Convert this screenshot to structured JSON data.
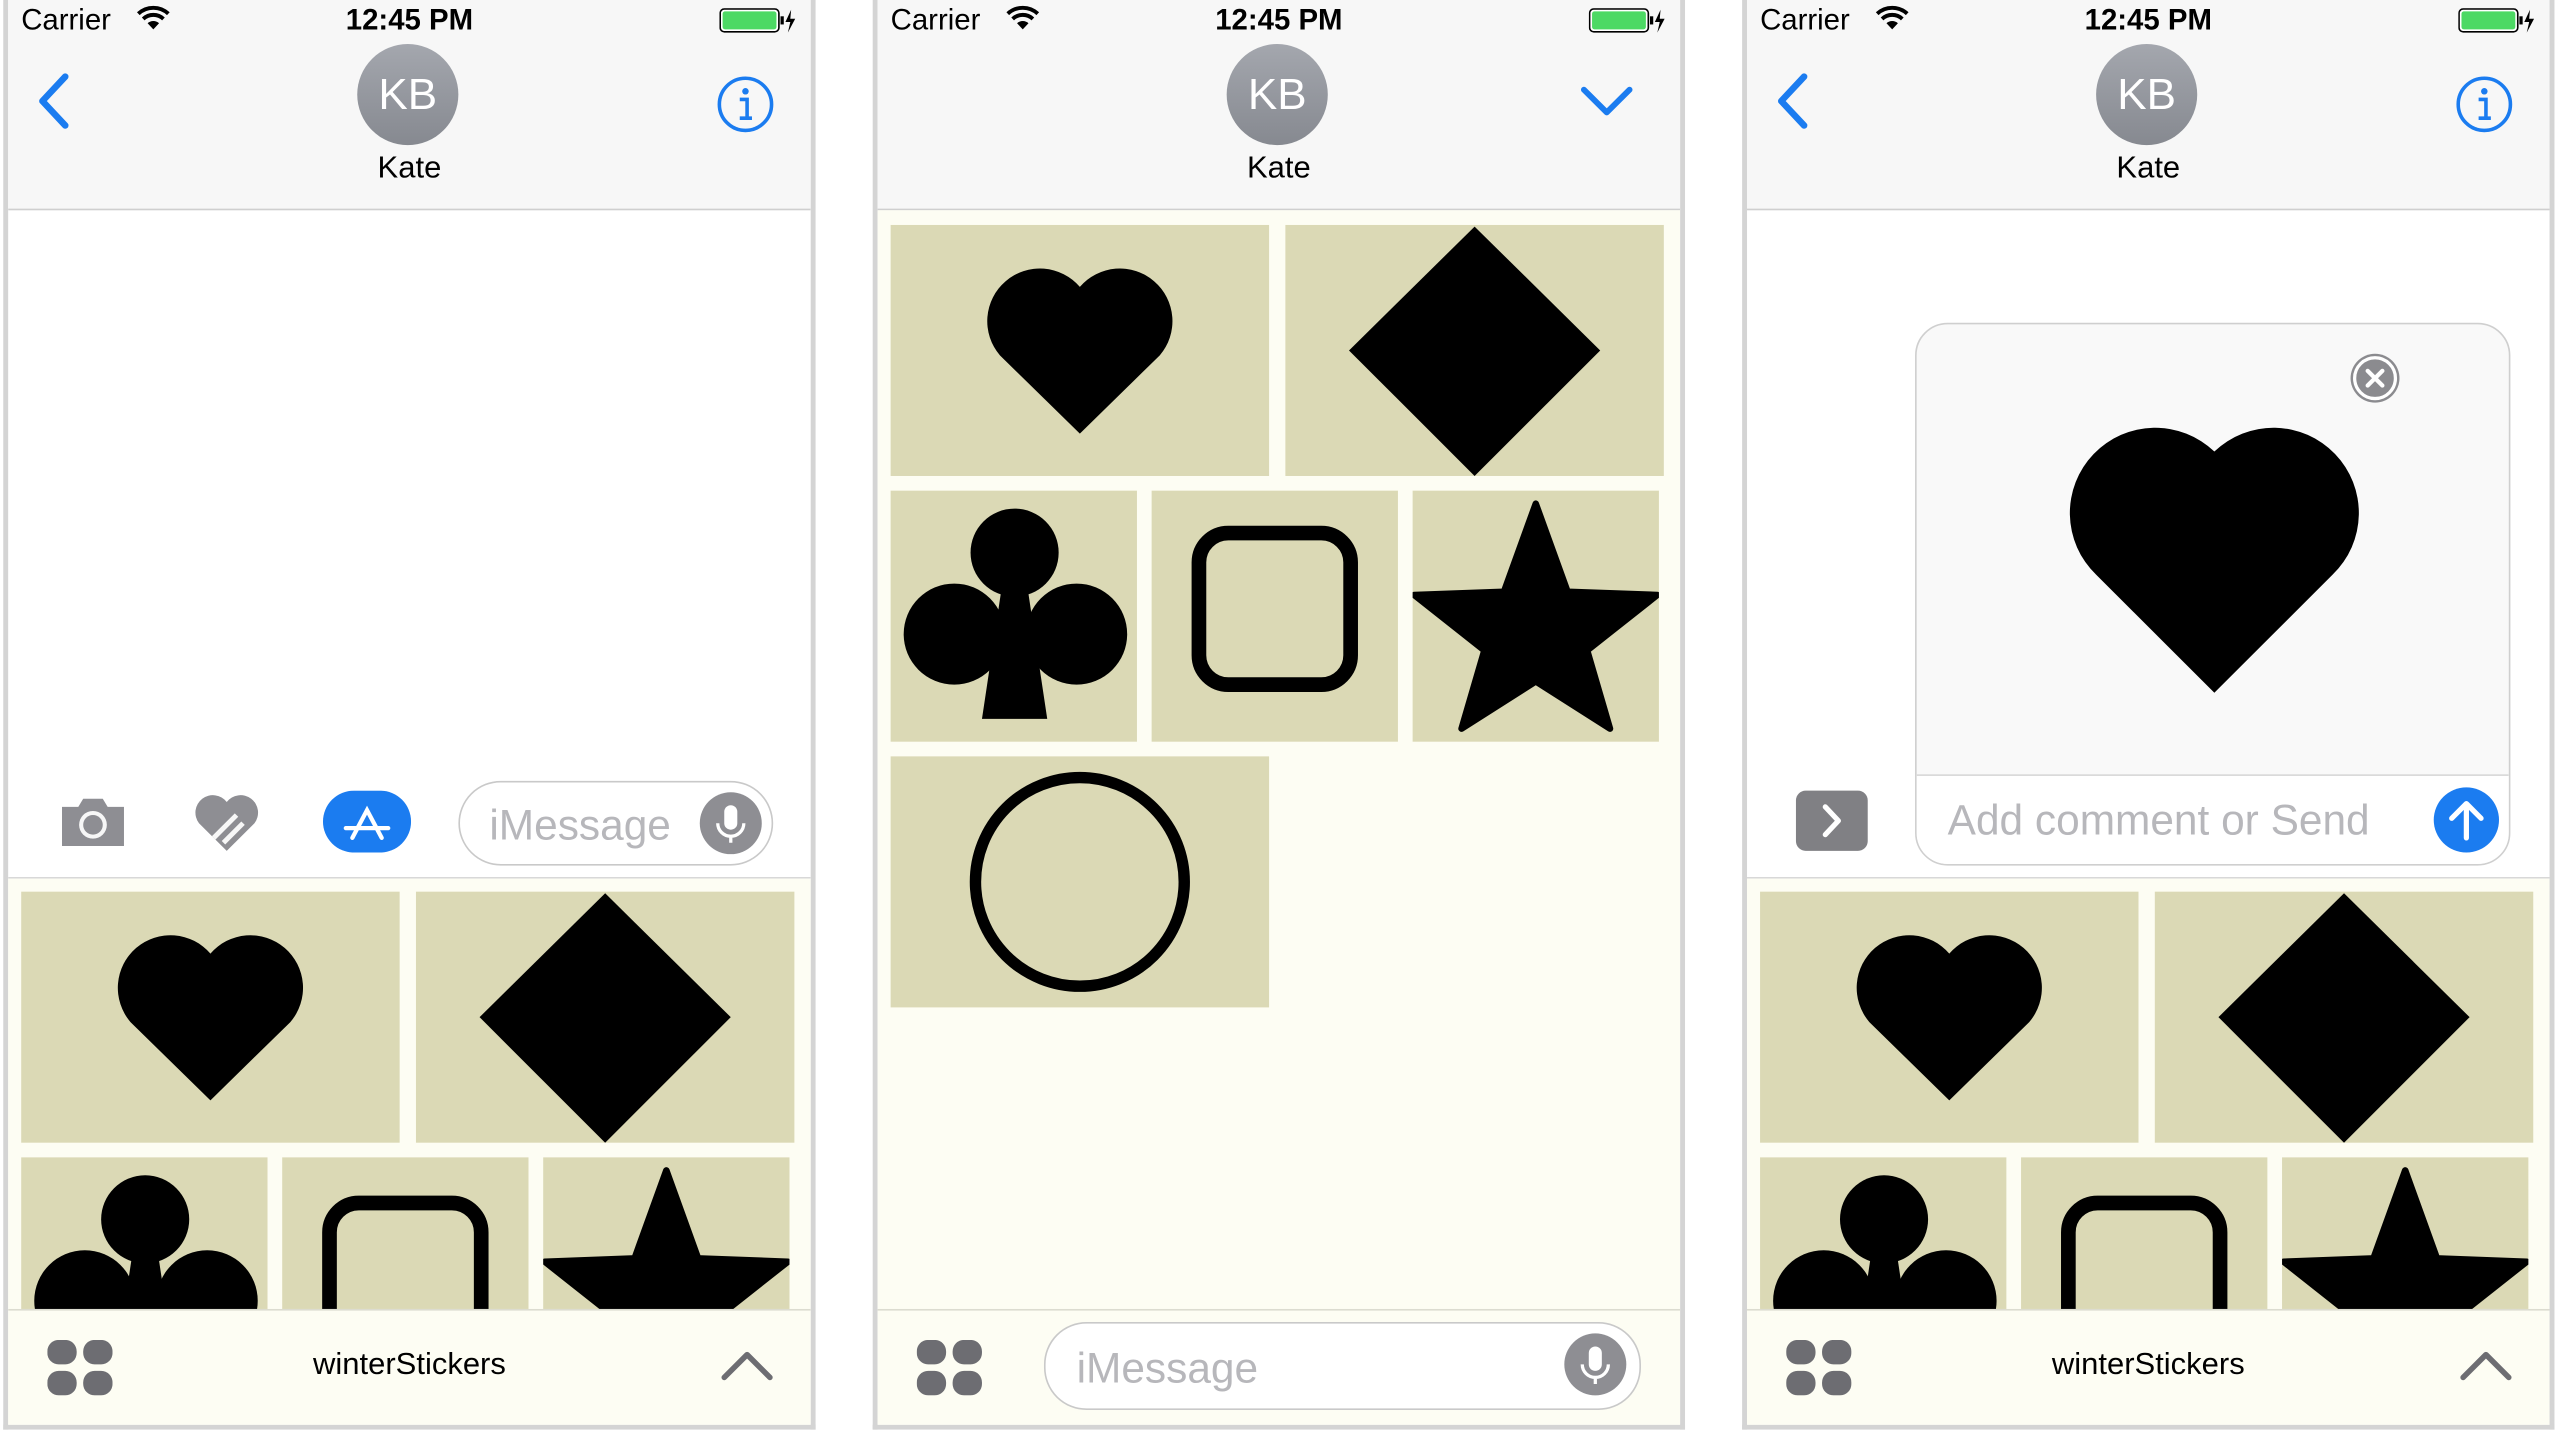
{
  "status_bar": {
    "carrier": "Carrier",
    "time": "12:45 PM"
  },
  "contact": {
    "initials": "KB",
    "name": "Kate"
  },
  "composer": {
    "placeholder": "iMessage"
  },
  "send_card": {
    "placeholder": "Add comment or Send"
  },
  "app_drawer": {
    "app_name": "winterStickers"
  },
  "stickers": [
    "heart",
    "diamond",
    "club",
    "rounded-square",
    "star",
    "circle"
  ],
  "colors": {
    "accent": "#1b7cf0",
    "tile": "#dbd9b5",
    "tray_bg": "#fdfdf3",
    "battery": "#4cd964"
  }
}
